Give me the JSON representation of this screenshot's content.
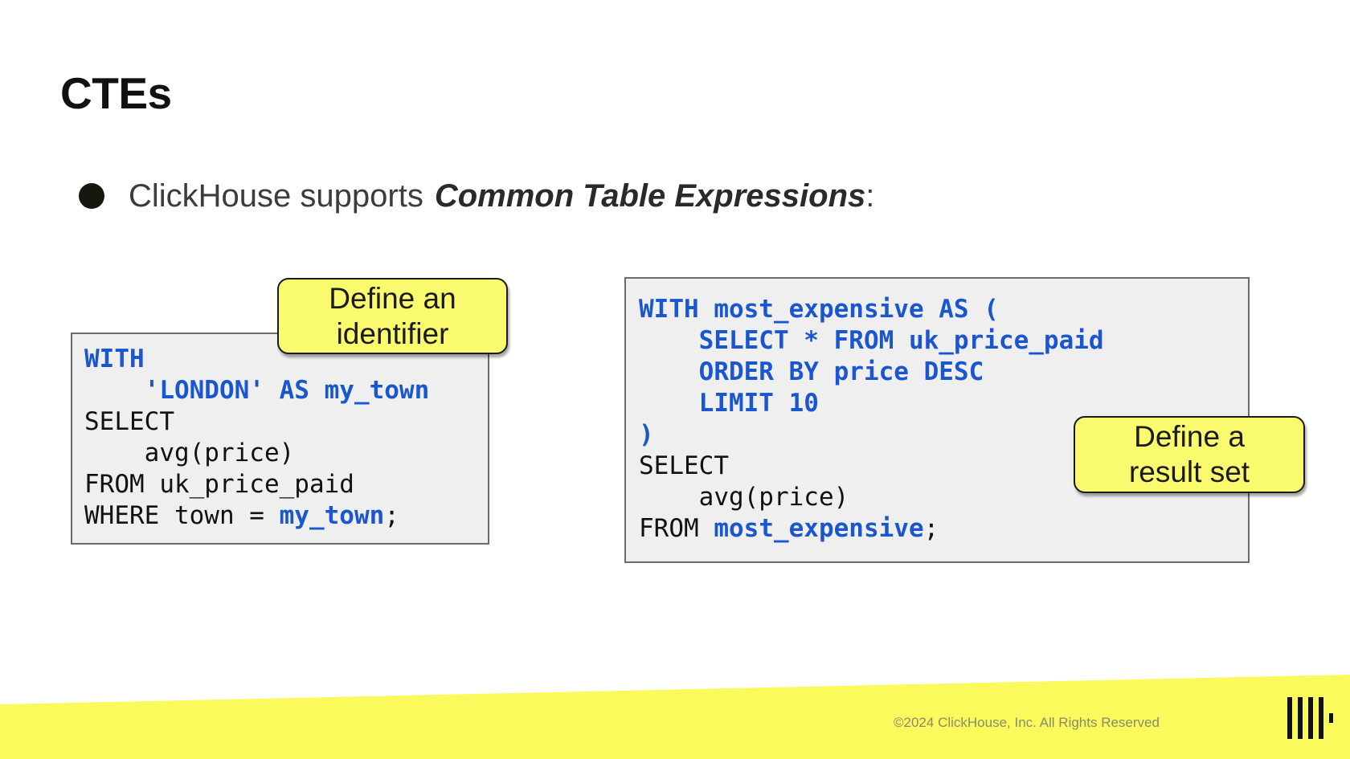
{
  "slide": {
    "title": "CTEs",
    "bullet": {
      "prefix": "ClickHouse supports",
      "emphasis": "Common Table Expressions",
      "suffix": ":"
    }
  },
  "left_example": {
    "lines": [
      {
        "parts": [
          {
            "text": "WITH",
            "style": "kw"
          }
        ]
      },
      {
        "parts": [
          {
            "text": "    'LONDON' AS my_town",
            "style": "kw"
          }
        ]
      },
      {
        "parts": [
          {
            "text": "SELECT",
            "style": "plain"
          }
        ]
      },
      {
        "parts": [
          {
            "text": "    avg(price)",
            "style": "plain"
          }
        ]
      },
      {
        "parts": [
          {
            "text": "FROM uk_price_paid",
            "style": "plain"
          }
        ]
      },
      {
        "parts": [
          {
            "text": "WHERE town = ",
            "style": "plain"
          },
          {
            "text": "my_town",
            "style": "kw"
          },
          {
            "text": ";",
            "style": "plain"
          }
        ]
      }
    ],
    "callout": [
      "Define an",
      "identifier"
    ]
  },
  "right_example": {
    "lines": [
      {
        "parts": [
          {
            "text": "WITH most_expensive AS (",
            "style": "kw"
          }
        ]
      },
      {
        "parts": [
          {
            "text": "    SELECT * FROM uk_price_paid",
            "style": "kw"
          }
        ]
      },
      {
        "parts": [
          {
            "text": "    ORDER BY price DESC",
            "style": "kw"
          }
        ]
      },
      {
        "parts": [
          {
            "text": "    LIMIT 10",
            "style": "kw"
          }
        ]
      },
      {
        "parts": [
          {
            "text": ")",
            "style": "kw"
          }
        ]
      },
      {
        "parts": [
          {
            "text": "SELECT",
            "style": "plain"
          }
        ]
      },
      {
        "parts": [
          {
            "text": "    avg(price)",
            "style": "plain"
          }
        ]
      },
      {
        "parts": [
          {
            "text": "FROM ",
            "style": "plain"
          },
          {
            "text": "most_expensive",
            "style": "kw"
          },
          {
            "text": ";",
            "style": "plain"
          }
        ]
      }
    ],
    "callout": [
      "Define a",
      "result set"
    ]
  },
  "footer": {
    "copyright": "©2024 ClickHouse, Inc. All Rights Reserved",
    "logo": "clickhouse-logo-icon",
    "band_color": "#fafa5c"
  },
  "colors": {
    "keyword": "#1a56cf",
    "code_background": "#efefef",
    "callout": "#fafa6e"
  }
}
